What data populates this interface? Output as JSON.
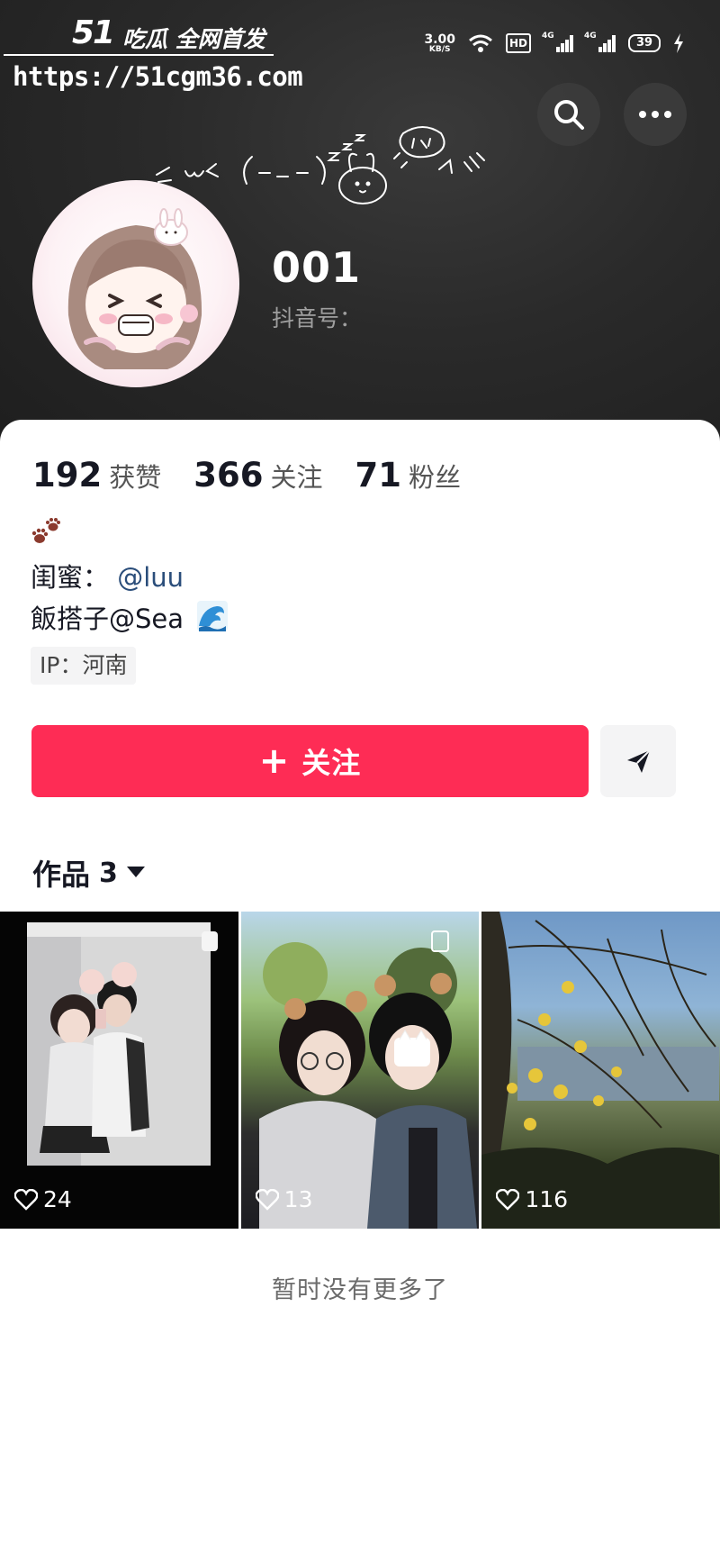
{
  "watermark": {
    "logo": "51",
    "tagline": "吃瓜 全网首发",
    "url": "https://51cgm36.com"
  },
  "status_bar": {
    "net_speed": "3.00",
    "net_unit": "KB/S",
    "hd": "HD",
    "signal_1": "4G",
    "signal_2": "4G",
    "battery": "39"
  },
  "header_actions": {
    "search_icon": "search-icon",
    "more_icon": "more-dots-icon"
  },
  "profile": {
    "name": "001",
    "douyin_id_label": "抖音号：",
    "doodle_text": "ᐡ•ﻌ•ᐡ"
  },
  "stats": [
    {
      "num": "192",
      "label": "获赞"
    },
    {
      "num": "366",
      "label": "关注"
    },
    {
      "num": "71",
      "label": "粉丝"
    }
  ],
  "bio": {
    "line1_prefix": "闺蜜：",
    "line1_mention": "@luu",
    "line2_text": "飯搭子@Sea"
  },
  "ip": "IP：河南",
  "actions": {
    "follow_plus": "+",
    "follow_label": "关注",
    "share_icon": "send-icon"
  },
  "works": {
    "label": "作品",
    "count": "3"
  },
  "videos": [
    {
      "likes": "24"
    },
    {
      "likes": "13"
    },
    {
      "likes": "116"
    }
  ],
  "footer": {
    "no_more": "暂时没有更多了"
  },
  "colors": {
    "accent": "#fe2c55",
    "header_bg": "#2a2a2a",
    "mention": "#2a4d7a"
  }
}
